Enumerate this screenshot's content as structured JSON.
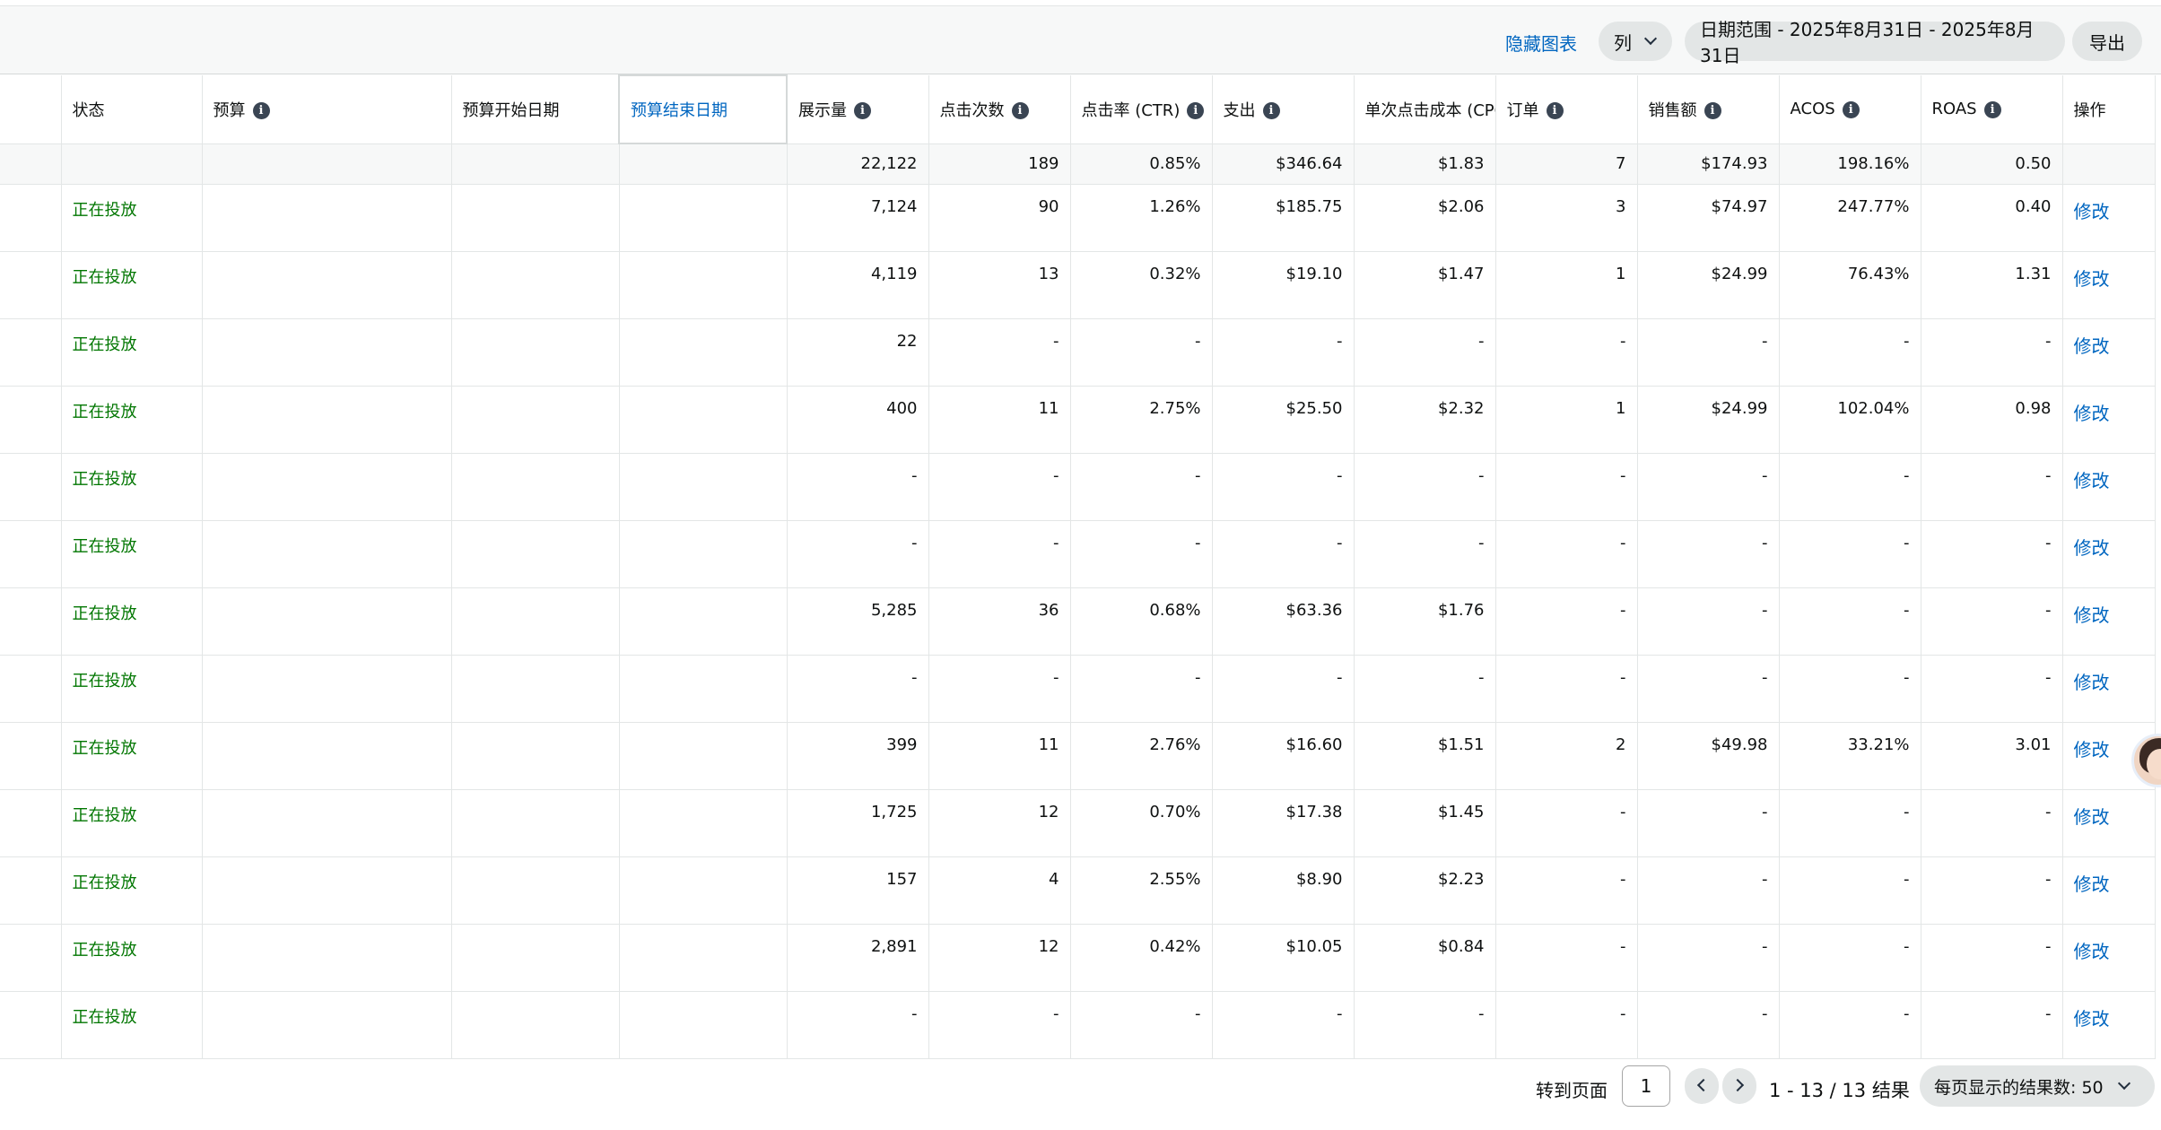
{
  "toolbar": {
    "hide_chart": "隐藏图表",
    "columns": "列",
    "date_range": "日期范围 - 2025年8月31日 - 2025年8月31日",
    "export": "导出"
  },
  "headers": [
    {
      "label": "状态",
      "info": false
    },
    {
      "label": "预算",
      "info": true
    },
    {
      "label": "预算开始日期",
      "info": false
    },
    {
      "label": "预算结束日期",
      "info": false
    },
    {
      "label": "展示量",
      "info": true
    },
    {
      "label": "点击次数",
      "info": true
    },
    {
      "label": "点击率 (CTR)",
      "info": true
    },
    {
      "label": "支出",
      "info": true
    },
    {
      "label": "单次点击成本 (CPC)",
      "info": false
    },
    {
      "label": "订单",
      "info": true
    },
    {
      "label": "销售额",
      "info": true
    },
    {
      "label": "ACOS",
      "info": true
    },
    {
      "label": "ROAS",
      "info": true
    },
    {
      "label": "操作",
      "info": false
    }
  ],
  "totals": [
    "22,122",
    "189",
    "0.85%",
    "$346.64",
    "$1.83",
    "7",
    "$174.93",
    "198.16%",
    "0.50"
  ],
  "rows": [
    {
      "status": "正在投放",
      "values": [
        "7,124",
        "90",
        "1.26%",
        "$185.75",
        "$2.06",
        "3",
        "$74.97",
        "247.77%",
        "0.40"
      ],
      "action": "修改"
    },
    {
      "status": "正在投放",
      "values": [
        "4,119",
        "13",
        "0.32%",
        "$19.10",
        "$1.47",
        "1",
        "$24.99",
        "76.43%",
        "1.31"
      ],
      "action": "修改"
    },
    {
      "status": "正在投放",
      "values": [
        "22",
        "-",
        "-",
        "-",
        "-",
        "-",
        "-",
        "-",
        "-"
      ],
      "action": "修改"
    },
    {
      "status": "正在投放",
      "values": [
        "400",
        "11",
        "2.75%",
        "$25.50",
        "$2.32",
        "1",
        "$24.99",
        "102.04%",
        "0.98"
      ],
      "action": "修改"
    },
    {
      "status": "正在投放",
      "values": [
        "-",
        "-",
        "-",
        "-",
        "-",
        "-",
        "-",
        "-",
        "-"
      ],
      "action": "修改"
    },
    {
      "status": "正在投放",
      "values": [
        "-",
        "-",
        "-",
        "-",
        "-",
        "-",
        "-",
        "-",
        "-"
      ],
      "action": "修改"
    },
    {
      "status": "正在投放",
      "values": [
        "5,285",
        "36",
        "0.68%",
        "$63.36",
        "$1.76",
        "-",
        "-",
        "-",
        "-"
      ],
      "action": "修改"
    },
    {
      "status": "正在投放",
      "values": [
        "-",
        "-",
        "-",
        "-",
        "-",
        "-",
        "-",
        "-",
        "-"
      ],
      "action": "修改"
    },
    {
      "status": "正在投放",
      "values": [
        "399",
        "11",
        "2.76%",
        "$16.60",
        "$1.51",
        "2",
        "$49.98",
        "33.21%",
        "3.01"
      ],
      "action": "修改"
    },
    {
      "status": "正在投放",
      "values": [
        "1,725",
        "12",
        "0.70%",
        "$17.38",
        "$1.45",
        "-",
        "-",
        "-",
        "-"
      ],
      "action": "修改"
    },
    {
      "status": "正在投放",
      "values": [
        "157",
        "4",
        "2.55%",
        "$8.90",
        "$2.23",
        "-",
        "-",
        "-",
        "-"
      ],
      "action": "修改"
    },
    {
      "status": "正在投放",
      "values": [
        "2,891",
        "12",
        "0.42%",
        "$10.05",
        "$0.84",
        "-",
        "-",
        "-",
        "-"
      ],
      "action": "修改"
    },
    {
      "status": "正在投放",
      "values": [
        "-",
        "-",
        "-",
        "-",
        "-",
        "-",
        "-",
        "-",
        "-"
      ],
      "action": "修改"
    }
  ],
  "pagination": {
    "goto_label": "转到页面",
    "page": "1",
    "results": "1 - 13 / 13 结果",
    "per_page": "每页显示的结果数:  50"
  },
  "colors": {
    "link": "#0066c0",
    "active_status": "#007600"
  }
}
